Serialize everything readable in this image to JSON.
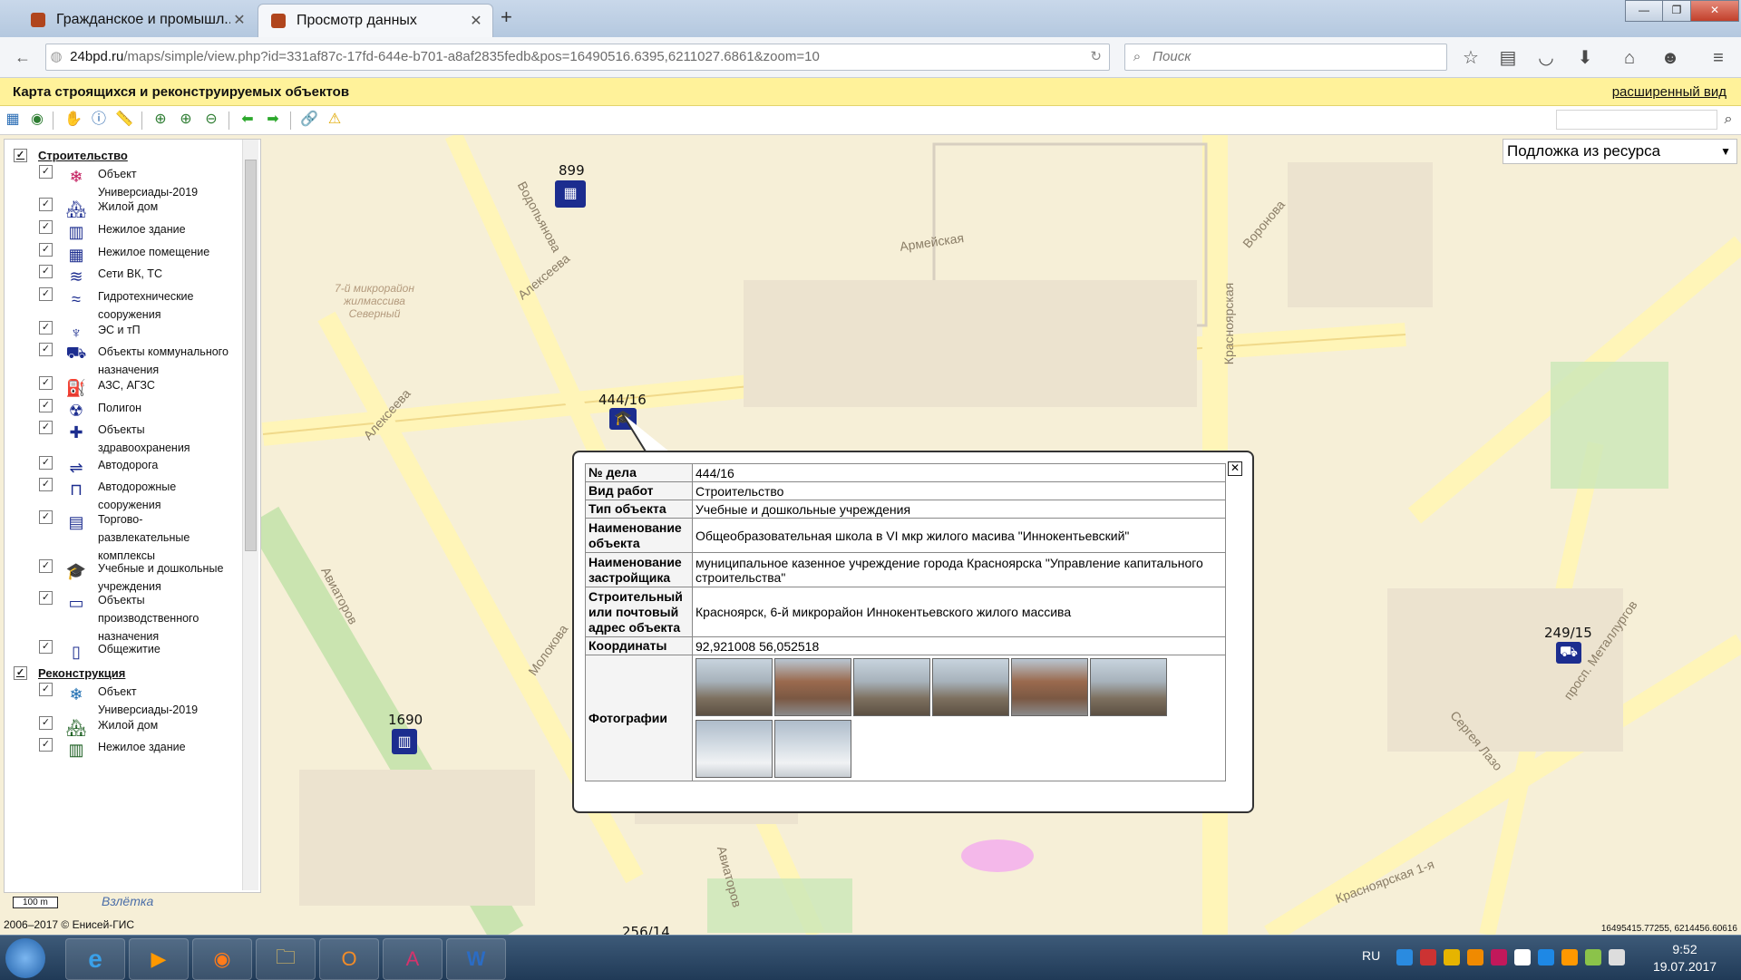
{
  "browser": {
    "tabs": [
      {
        "label": "Гражданское и промышл...",
        "active": false
      },
      {
        "label": "Просмотр данных",
        "active": true
      }
    ],
    "url_host": "24bpd.ru",
    "url_rest": "/maps/simple/view.php?id=331af87c-17fd-644e-b701-a8af2835fedb&pos=16490516.6395,6211027.6861&zoom=10",
    "search_placeholder": "Поиск"
  },
  "app": {
    "title": "Карта строящихся и реконструируемых объектов",
    "extended_view_link": "расширенный вид",
    "basemap_select": "Подложка из ресурса"
  },
  "layers": {
    "group1": {
      "label": "Строительство",
      "items": [
        {
          "label": "Объект Универсиады-2019",
          "icon": "snowflake-icon"
        },
        {
          "label": "Жилой дом",
          "icon": "residential-house-icon"
        },
        {
          "label": "Нежилое здание",
          "icon": "non-residential-building-icon"
        },
        {
          "label": "Нежилое помещение",
          "icon": "non-residential-premises-icon"
        },
        {
          "label": "Сети ВК, ТС",
          "icon": "water-networks-icon"
        },
        {
          "label": "Гидротехнические сооружения",
          "icon": "hydro-structure-icon"
        },
        {
          "label": "ЭС и тП",
          "icon": "power-tower-icon"
        },
        {
          "label": "Объекты коммунального назначения",
          "icon": "utility-truck-icon"
        },
        {
          "label": "АЗС, АГЗС",
          "icon": "gas-station-icon"
        },
        {
          "label": "Полигон",
          "icon": "landfill-icon"
        },
        {
          "label": "Объекты здравоохранения",
          "icon": "healthcare-icon"
        },
        {
          "label": "Автодорога",
          "icon": "road-icon"
        },
        {
          "label": "Автодорожные сооружения",
          "icon": "road-structure-icon"
        },
        {
          "label": "Торгово-развлекательные комплексы",
          "icon": "shopping-center-icon"
        },
        {
          "label": "Учебные и дошкольные учреждения",
          "icon": "education-icon"
        },
        {
          "label": "Объекты производственного назначения",
          "icon": "factory-icon"
        },
        {
          "label": "Общежитие",
          "icon": "dormitory-icon"
        }
      ]
    },
    "group2": {
      "label": "Реконструкция",
      "items": [
        {
          "label": "Объект Универсиады-2019",
          "icon": "snowflake-icon"
        },
        {
          "label": "Жилой дом",
          "icon": "residential-house-icon"
        },
        {
          "label": "Нежилое здание",
          "icon": "non-residential-building-icon"
        }
      ]
    }
  },
  "map": {
    "markers": [
      {
        "label": "899"
      },
      {
        "label": "444/16"
      },
      {
        "label": "249/15"
      },
      {
        "label": "1690"
      },
      {
        "label": "256/14"
      }
    ],
    "streets": [
      "Водопьянова",
      "Армейская",
      "Воронова",
      "Алексеева",
      "Алексеева",
      "Красноярская",
      "Авиаторов",
      "Молокова",
      "Авиаторов",
      "просп. Металлургов",
      "Сергея Лазо",
      "Красноярская 1-я",
      "Взлётка",
      "7-й микрорайон жилмассива Северный"
    ],
    "scale_label": "100 m",
    "copyright": "2006–2017 © Енисей-ГИС",
    "coords": "16495415.77255, 6214456.60616"
  },
  "popup": {
    "rows": [
      {
        "key": "№ дела",
        "value": "444/16"
      },
      {
        "key": "Вид работ",
        "value": "Строительство"
      },
      {
        "key": "Тип объекта",
        "value": "Учебные и дошкольные учреждения"
      },
      {
        "key": "Наименование объекта",
        "value": "Общеобразовательная школа в VI мкр жилого масива \"Иннокентьевский\""
      },
      {
        "key": "Наименование застройщика",
        "value": "муниципальное казенное учреждение города Красноярска \"Управление капитального строительства\""
      },
      {
        "key": "Строительный или почтовый адрес объекта",
        "value": "Красноярск, 6-й микрорайон Иннокентьевского жилого массива"
      },
      {
        "key": "Координаты",
        "value": "92,921008 56,052518"
      }
    ],
    "photos_label": "Фотографии",
    "photo_count": 8,
    "close_symbol": "✕"
  },
  "taskbar": {
    "language": "RU",
    "time": "9:52",
    "date": "19.07.2017"
  }
}
